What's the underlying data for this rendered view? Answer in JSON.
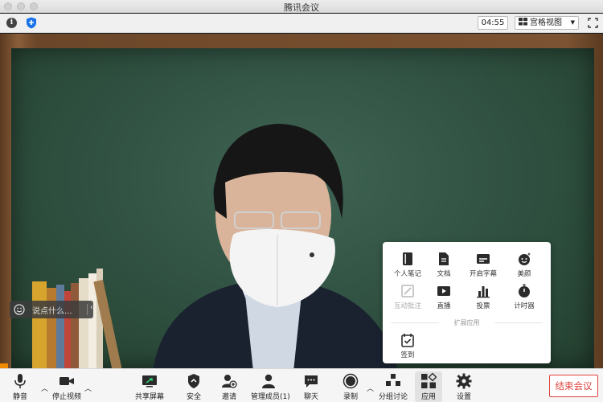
{
  "window": {
    "title": "腾讯会议"
  },
  "toolbar": {
    "info_icon": "i",
    "timer": "04:55",
    "view_label": "宫格视图"
  },
  "chat": {
    "placeholder": "说点什么..."
  },
  "apps_panel": {
    "section_label": "扩展应用",
    "apps": [
      {
        "label": "个人笔记",
        "icon": "notebook-icon",
        "disabled": false
      },
      {
        "label": "文档",
        "icon": "document-icon",
        "disabled": false
      },
      {
        "label": "开启字幕",
        "icon": "subtitle-icon",
        "disabled": false
      },
      {
        "label": "美颜",
        "icon": "beauty-icon",
        "disabled": false
      },
      {
        "label": "互动批注",
        "icon": "annotate-icon",
        "disabled": true
      },
      {
        "label": "直播",
        "icon": "live-icon",
        "disabled": false
      },
      {
        "label": "投票",
        "icon": "vote-icon",
        "disabled": false
      },
      {
        "label": "计时器",
        "icon": "timer-icon",
        "disabled": false
      }
    ],
    "extension": {
      "label": "签到",
      "icon": "checkin-icon"
    }
  },
  "bottom_bar": {
    "mute": "静音",
    "stop_video": "停止视频",
    "share_screen": "共享屏幕",
    "security": "安全",
    "invite": "邀请",
    "manage_members": "管理成员(1)",
    "chat": "聊天",
    "record": "录制",
    "breakout": "分组讨论",
    "apps": "应用",
    "settings": "设置",
    "end_meeting": "结束会议"
  },
  "colors": {
    "accent_blue": "#1a73e8",
    "end_red": "#e0433e",
    "tag_orange": "#f08a00"
  }
}
